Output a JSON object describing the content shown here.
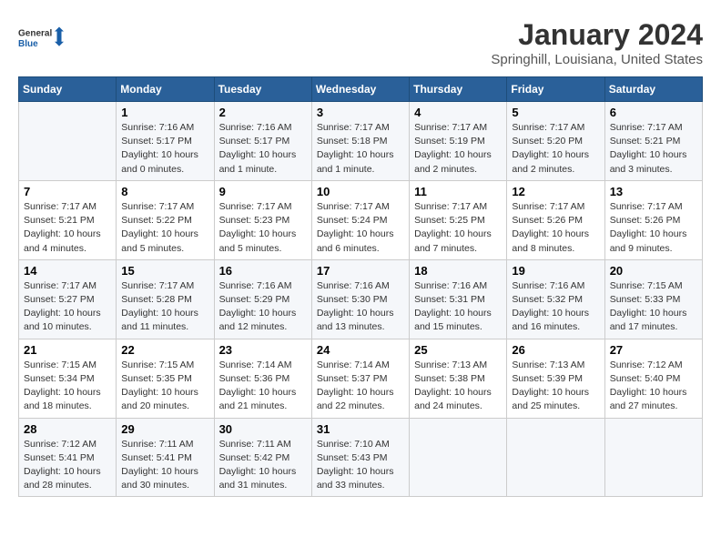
{
  "header": {
    "logo_line1": "General",
    "logo_line2": "Blue",
    "month": "January 2024",
    "location": "Springhill, Louisiana, United States"
  },
  "days_of_week": [
    "Sunday",
    "Monday",
    "Tuesday",
    "Wednesday",
    "Thursday",
    "Friday",
    "Saturday"
  ],
  "weeks": [
    [
      {
        "day": "",
        "info": ""
      },
      {
        "day": "1",
        "info": "Sunrise: 7:16 AM\nSunset: 5:17 PM\nDaylight: 10 hours\nand 0 minutes."
      },
      {
        "day": "2",
        "info": "Sunrise: 7:16 AM\nSunset: 5:17 PM\nDaylight: 10 hours\nand 1 minute."
      },
      {
        "day": "3",
        "info": "Sunrise: 7:17 AM\nSunset: 5:18 PM\nDaylight: 10 hours\nand 1 minute."
      },
      {
        "day": "4",
        "info": "Sunrise: 7:17 AM\nSunset: 5:19 PM\nDaylight: 10 hours\nand 2 minutes."
      },
      {
        "day": "5",
        "info": "Sunrise: 7:17 AM\nSunset: 5:20 PM\nDaylight: 10 hours\nand 2 minutes."
      },
      {
        "day": "6",
        "info": "Sunrise: 7:17 AM\nSunset: 5:21 PM\nDaylight: 10 hours\nand 3 minutes."
      }
    ],
    [
      {
        "day": "7",
        "info": "Sunrise: 7:17 AM\nSunset: 5:21 PM\nDaylight: 10 hours\nand 4 minutes."
      },
      {
        "day": "8",
        "info": "Sunrise: 7:17 AM\nSunset: 5:22 PM\nDaylight: 10 hours\nand 5 minutes."
      },
      {
        "day": "9",
        "info": "Sunrise: 7:17 AM\nSunset: 5:23 PM\nDaylight: 10 hours\nand 5 minutes."
      },
      {
        "day": "10",
        "info": "Sunrise: 7:17 AM\nSunset: 5:24 PM\nDaylight: 10 hours\nand 6 minutes."
      },
      {
        "day": "11",
        "info": "Sunrise: 7:17 AM\nSunset: 5:25 PM\nDaylight: 10 hours\nand 7 minutes."
      },
      {
        "day": "12",
        "info": "Sunrise: 7:17 AM\nSunset: 5:26 PM\nDaylight: 10 hours\nand 8 minutes."
      },
      {
        "day": "13",
        "info": "Sunrise: 7:17 AM\nSunset: 5:26 PM\nDaylight: 10 hours\nand 9 minutes."
      }
    ],
    [
      {
        "day": "14",
        "info": "Sunrise: 7:17 AM\nSunset: 5:27 PM\nDaylight: 10 hours\nand 10 minutes."
      },
      {
        "day": "15",
        "info": "Sunrise: 7:17 AM\nSunset: 5:28 PM\nDaylight: 10 hours\nand 11 minutes."
      },
      {
        "day": "16",
        "info": "Sunrise: 7:16 AM\nSunset: 5:29 PM\nDaylight: 10 hours\nand 12 minutes."
      },
      {
        "day": "17",
        "info": "Sunrise: 7:16 AM\nSunset: 5:30 PM\nDaylight: 10 hours\nand 13 minutes."
      },
      {
        "day": "18",
        "info": "Sunrise: 7:16 AM\nSunset: 5:31 PM\nDaylight: 10 hours\nand 15 minutes."
      },
      {
        "day": "19",
        "info": "Sunrise: 7:16 AM\nSunset: 5:32 PM\nDaylight: 10 hours\nand 16 minutes."
      },
      {
        "day": "20",
        "info": "Sunrise: 7:15 AM\nSunset: 5:33 PM\nDaylight: 10 hours\nand 17 minutes."
      }
    ],
    [
      {
        "day": "21",
        "info": "Sunrise: 7:15 AM\nSunset: 5:34 PM\nDaylight: 10 hours\nand 18 minutes."
      },
      {
        "day": "22",
        "info": "Sunrise: 7:15 AM\nSunset: 5:35 PM\nDaylight: 10 hours\nand 20 minutes."
      },
      {
        "day": "23",
        "info": "Sunrise: 7:14 AM\nSunset: 5:36 PM\nDaylight: 10 hours\nand 21 minutes."
      },
      {
        "day": "24",
        "info": "Sunrise: 7:14 AM\nSunset: 5:37 PM\nDaylight: 10 hours\nand 22 minutes."
      },
      {
        "day": "25",
        "info": "Sunrise: 7:13 AM\nSunset: 5:38 PM\nDaylight: 10 hours\nand 24 minutes."
      },
      {
        "day": "26",
        "info": "Sunrise: 7:13 AM\nSunset: 5:39 PM\nDaylight: 10 hours\nand 25 minutes."
      },
      {
        "day": "27",
        "info": "Sunrise: 7:12 AM\nSunset: 5:40 PM\nDaylight: 10 hours\nand 27 minutes."
      }
    ],
    [
      {
        "day": "28",
        "info": "Sunrise: 7:12 AM\nSunset: 5:41 PM\nDaylight: 10 hours\nand 28 minutes."
      },
      {
        "day": "29",
        "info": "Sunrise: 7:11 AM\nSunset: 5:41 PM\nDaylight: 10 hours\nand 30 minutes."
      },
      {
        "day": "30",
        "info": "Sunrise: 7:11 AM\nSunset: 5:42 PM\nDaylight: 10 hours\nand 31 minutes."
      },
      {
        "day": "31",
        "info": "Sunrise: 7:10 AM\nSunset: 5:43 PM\nDaylight: 10 hours\nand 33 minutes."
      },
      {
        "day": "",
        "info": ""
      },
      {
        "day": "",
        "info": ""
      },
      {
        "day": "",
        "info": ""
      }
    ]
  ]
}
